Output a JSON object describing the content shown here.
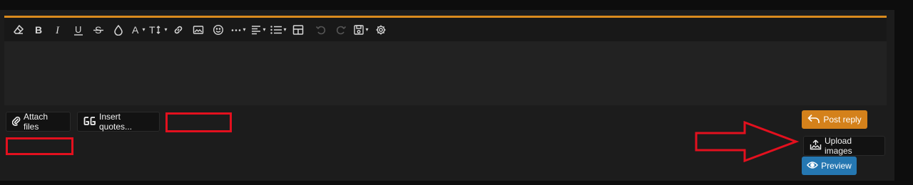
{
  "colors": {
    "accent": "#d98a1e",
    "post_reply_bg": "#d4811b",
    "preview_bg": "#2577b1",
    "annotation_red": "#e3101e"
  },
  "toolbar": {
    "buttons": [
      {
        "name": "remove-formatting-icon"
      },
      {
        "name": "bold-icon"
      },
      {
        "name": "italic-icon"
      },
      {
        "name": "underline-icon"
      },
      {
        "name": "strikethrough-icon"
      },
      {
        "name": "text-color-icon"
      },
      {
        "name": "font-family-icon"
      },
      {
        "name": "font-size-icon"
      },
      {
        "name": "link-icon"
      },
      {
        "name": "image-icon"
      },
      {
        "name": "emoji-icon"
      },
      {
        "name": "more-options-icon"
      },
      {
        "name": "align-icon"
      },
      {
        "name": "list-icon"
      },
      {
        "name": "table-icon"
      },
      {
        "name": "undo-icon"
      },
      {
        "name": "redo-icon"
      },
      {
        "name": "drafts-icon"
      },
      {
        "name": "settings-gear-icon"
      }
    ]
  },
  "actions": {
    "attach_files": "Attach files",
    "insert_quotes": "Insert quotes...",
    "post_reply": "Post reply",
    "upload_images": "Upload images",
    "preview": "Preview"
  }
}
